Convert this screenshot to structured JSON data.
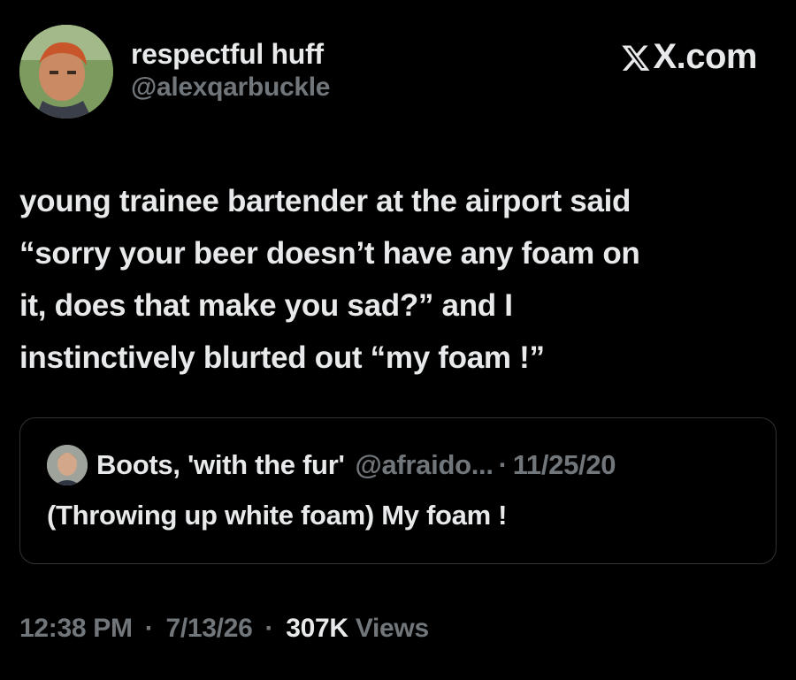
{
  "author": {
    "display_name": "respectful huff",
    "handle": "@alexqarbuckle",
    "avatar_icon": "profile-photo"
  },
  "brand": {
    "label": "X.com",
    "icon": "x-logo-icon"
  },
  "tweet": {
    "lines": [
      "young trainee bartender at the airport said",
      "“sorry your beer doesn’t have any foam on",
      "it, does that make you sad?” and I",
      "instinctively blurted out “my foam !”"
    ]
  },
  "quoted_tweet": {
    "display_name": "Boots, 'with the fur'",
    "handle": "@afraido...",
    "separator": "·",
    "date": "11/25/20",
    "text": "(Throwing up white foam) My foam !"
  },
  "meta": {
    "time": "12:38 PM",
    "separator": "·",
    "date": "7/13/26",
    "views_count": "307K",
    "views_label": "Views"
  },
  "colors": {
    "background": "#000000",
    "primary_text": "#e7e9ea",
    "secondary_text": "#71767b",
    "border": "#2f3336"
  }
}
